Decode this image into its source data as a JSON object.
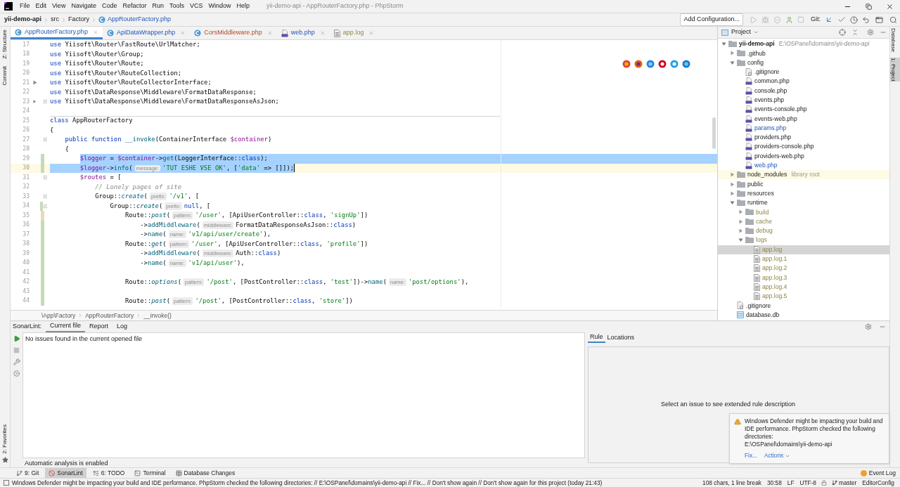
{
  "menu": [
    "File",
    "Edit",
    "View",
    "Navigate",
    "Code",
    "Refactor",
    "Run",
    "Tools",
    "VCS",
    "Window",
    "Help"
  ],
  "window_title": "yii-demo-api - AppRouterFactory.php - PhpStorm",
  "nav_path": [
    {
      "label": "yii-demo-api",
      "kind": "project"
    },
    {
      "label": "src",
      "kind": "folder"
    },
    {
      "label": "Factory",
      "kind": "folder"
    },
    {
      "label": "AppRouterFactory.php",
      "kind": "class"
    }
  ],
  "run_config": "Add Configuration...",
  "vcs_label": "Git:",
  "tabs": [
    {
      "label": "AppRouterFactory.php",
      "kind": "class",
      "modified": true,
      "has_errors": false,
      "ignored": false,
      "selected": true
    },
    {
      "label": "ApiDataWrapper.php",
      "kind": "class",
      "modified": true,
      "has_errors": false,
      "ignored": false,
      "selected": false
    },
    {
      "label": "CorsMiddleware.php",
      "kind": "class",
      "modified": false,
      "has_errors": true,
      "ignored": false,
      "selected": false
    },
    {
      "label": "web.php",
      "kind": "php",
      "modified": true,
      "has_errors": false,
      "ignored": false,
      "selected": false
    },
    {
      "label": "app.log",
      "kind": "log",
      "modified": false,
      "has_errors": false,
      "ignored": true,
      "selected": false
    }
  ],
  "lines": [
    {
      "number": "17",
      "tokens": [
        {
          "kind": "kw",
          "text": "use "
        },
        {
          "kind": "plain",
          "text": "Yiisoft\\Router\\FastRoute\\UrlMatcher;"
        }
      ]
    },
    {
      "number": "18",
      "tokens": [
        {
          "kind": "kw",
          "text": "use "
        },
        {
          "kind": "plain",
          "text": "Yiisoft\\Router\\Group;"
        }
      ]
    },
    {
      "number": "19",
      "tokens": [
        {
          "kind": "kw",
          "text": "use "
        },
        {
          "kind": "plain",
          "text": "Yiisoft\\Router\\Route;"
        }
      ]
    },
    {
      "number": "20",
      "tokens": [
        {
          "kind": "kw",
          "text": "use "
        },
        {
          "kind": "plain",
          "text": "Yiisoft\\Router\\RouteCollection;"
        }
      ]
    },
    {
      "number": "21",
      "arrow": true,
      "tokens": [
        {
          "kind": "kw",
          "text": "use "
        },
        {
          "kind": "plain",
          "text": "Yiisoft\\Router\\RouteCollectorInterface;"
        }
      ]
    },
    {
      "number": "22",
      "tokens": [
        {
          "kind": "kw",
          "text": "use "
        },
        {
          "kind": "plain",
          "text": "Yiisoft\\DataResponse\\Middleware\\FormatDataResponse;"
        }
      ]
    },
    {
      "number": "23",
      "arrow": true,
      "fold": true,
      "tokens": [
        {
          "kind": "kw",
          "text": "use "
        },
        {
          "kind": "plain",
          "text": "Yiisoft\\DataResponse\\Middleware\\FormatDataResponseAsJson;"
        }
      ]
    },
    {
      "number": "24"
    },
    {
      "number": "25",
      "separator": true,
      "tokens": [
        {
          "kind": "kw",
          "text": "class "
        },
        {
          "kind": "plain",
          "text": "AppRouterFactory"
        }
      ]
    },
    {
      "number": "26",
      "tokens": [
        {
          "kind": "plain",
          "text": "{"
        }
      ],
      "children": [
        {
          "number": "27",
          "fold": true,
          "tokens": [
            {
              "kind": "kw",
              "text": "public function "
            },
            {
              "kind": "fn",
              "text": "__invoke"
            },
            {
              "kind": "plain",
              "text": "(ContainerInterface "
            },
            {
              "kind": "var",
              "text": "$container"
            },
            {
              "kind": "plain",
              "text": ")"
            }
          ]
        },
        {
          "number": "28",
          "tokens": [
            {
              "kind": "plain",
              "text": "{"
            }
          ],
          "children": [
            {
              "number": "29",
              "color": "#c3dcb6",
              "highlighted": true,
              "tokens": [
                {
                  "kind": "var",
                  "text": "$logger"
                },
                {
                  "kind": "plain",
                  "text": " = "
                },
                {
                  "kind": "var",
                  "text": "$container"
                },
                {
                  "kind": "plain",
                  "text": "->"
                },
                {
                  "kind": "fn",
                  "text": "get"
                },
                {
                  "kind": "plain",
                  "text": "(LoggerInterface::"
                },
                {
                  "kind": "kw",
                  "text": "class"
                },
                {
                  "kind": "plain",
                  "text": ");"
                }
              ]
            },
            {
              "number": "30",
              "color": "#c3dcb6",
              "highlighted": true,
              "caret": true,
              "tokens": [
                {
                  "kind": "var",
                  "text": "$logger"
                },
                {
                  "kind": "plain",
                  "text": "->"
                },
                {
                  "kind": "fn",
                  "text": "info"
                },
                {
                  "kind": "plain",
                  "text": "("
                },
                {
                  "kind": "hint",
                  "text": "message:"
                },
                {
                  "kind": "str",
                  "text": "'TUT ESHE VSE OK'"
                },
                {
                  "kind": "plain",
                  "text": ", ["
                },
                {
                  "kind": "str",
                  "text": "'data'"
                },
                {
                  "kind": "plain",
                  "text": " => []]);"
                }
              ]
            },
            {
              "number": "31",
              "fold": true,
              "tokens": [
                {
                  "kind": "var",
                  "text": "$routes"
                },
                {
                  "kind": "plain",
                  "text": " = ["
                }
              ],
              "children": [
                {
                  "number": "32",
                  "tokens": [
                    {
                      "kind": "comment",
                      "text": "// Lonely pages of site"
                    }
                  ]
                },
                {
                  "number": "33",
                  "fold": true,
                  "tokens": [
                    {
                      "kind": "plain",
                      "text": "Group::"
                    },
                    {
                      "kind": "static",
                      "text": "create"
                    },
                    {
                      "kind": "plain",
                      "text": "("
                    },
                    {
                      "kind": "hint",
                      "text": "prefix:"
                    },
                    {
                      "kind": "str",
                      "text": "'/v1'"
                    },
                    {
                      "kind": "plain",
                      "text": ", ["
                    }
                  ],
                  "children": [
                    {
                      "number": "34",
                      "fold": true,
                      "color": "#c3dcb6",
                      "tokens": [
                        {
                          "kind": "plain",
                          "text": "Group::"
                        },
                        {
                          "kind": "static",
                          "text": "create"
                        },
                        {
                          "kind": "plain",
                          "text": "("
                        },
                        {
                          "kind": "hint",
                          "text": "prefix:"
                        },
                        {
                          "kind": "kw",
                          "text": "null"
                        },
                        {
                          "kind": "plain",
                          "text": ", ["
                        }
                      ],
                      "children": [
                        {
                          "number": "35",
                          "color": "#ead9b6",
                          "tokens": [
                            {
                              "kind": "plain",
                              "text": "Route::"
                            },
                            {
                              "kind": "static",
                              "text": "post"
                            },
                            {
                              "kind": "plain",
                              "text": "("
                            },
                            {
                              "kind": "hint",
                              "text": "pattern:"
                            },
                            {
                              "kind": "str",
                              "text": "'/user'"
                            },
                            {
                              "kind": "plain",
                              "text": ", [ApiUserController::"
                            },
                            {
                              "kind": "kw",
                              "text": "class"
                            },
                            {
                              "kind": "plain",
                              "text": ", "
                            },
                            {
                              "kind": "str",
                              "text": "'signUp'"
                            },
                            {
                              "kind": "plain",
                              "text": "])"
                            }
                          ],
                          "children": [
                            {
                              "number": "36",
                              "color": "#c3dcb6",
                              "tokens": [
                                {
                                  "kind": "plain",
                                  "text": "->"
                                },
                                {
                                  "kind": "fn",
                                  "text": "addMiddleware"
                                },
                                {
                                  "kind": "plain",
                                  "text": "("
                                },
                                {
                                  "kind": "hint",
                                  "text": "middleware:"
                                },
                                {
                                  "kind": "plain",
                                  "text": "FormatDataResponseAsJson::"
                                },
                                {
                                  "kind": "kw",
                                  "text": "class"
                                },
                                {
                                  "kind": "plain",
                                  "text": ")"
                                }
                              ]
                            },
                            {
                              "number": "37",
                              "color": "#c3dcb6",
                              "tokens": [
                                {
                                  "kind": "plain",
                                  "text": "->"
                                },
                                {
                                  "kind": "fn",
                                  "text": "name"
                                },
                                {
                                  "kind": "plain",
                                  "text": "("
                                },
                                {
                                  "kind": "hint",
                                  "text": "name:"
                                },
                                {
                                  "kind": "str",
                                  "text": "'v1/api/user/create'"
                                },
                                {
                                  "kind": "plain",
                                  "text": "),"
                                }
                              ]
                            }
                          ]
                        },
                        {
                          "number": "38",
                          "color": "#c3dcb6",
                          "tokens": [
                            {
                              "kind": "plain",
                              "text": "Route::"
                            },
                            {
                              "kind": "static",
                              "text": "get"
                            },
                            {
                              "kind": "plain",
                              "text": "("
                            },
                            {
                              "kind": "hint",
                              "text": "pattern:"
                            },
                            {
                              "kind": "str",
                              "text": "'/user'"
                            },
                            {
                              "kind": "plain",
                              "text": ", [ApiUserController::"
                            },
                            {
                              "kind": "kw",
                              "text": "class"
                            },
                            {
                              "kind": "plain",
                              "text": ", "
                            },
                            {
                              "kind": "str",
                              "text": "'profile'"
                            },
                            {
                              "kind": "plain",
                              "text": "])"
                            }
                          ],
                          "children": [
                            {
                              "number": "39",
                              "color": "#c3dcb6",
                              "tokens": [
                                {
                                  "kind": "plain",
                                  "text": "->"
                                },
                                {
                                  "kind": "fn",
                                  "text": "addMiddleware"
                                },
                                {
                                  "kind": "plain",
                                  "text": "("
                                },
                                {
                                  "kind": "hint",
                                  "text": "middleware:"
                                },
                                {
                                  "kind": "plain",
                                  "text": "Auth::"
                                },
                                {
                                  "kind": "kw",
                                  "text": "class"
                                },
                                {
                                  "kind": "plain",
                                  "text": ")"
                                }
                              ]
                            },
                            {
                              "number": "40",
                              "color": "#c3dcb6",
                              "tokens": [
                                {
                                  "kind": "plain",
                                  "text": "->"
                                },
                                {
                                  "kind": "fn",
                                  "text": "name"
                                },
                                {
                                  "kind": "plain",
                                  "text": "("
                                },
                                {
                                  "kind": "hint",
                                  "text": "name:"
                                },
                                {
                                  "kind": "str",
                                  "text": "'v1/api/user'"
                                },
                                {
                                  "kind": "plain",
                                  "text": "),"
                                }
                              ]
                            }
                          ]
                        },
                        {
                          "number": "41",
                          "color": "#c3dcb6"
                        },
                        {
                          "number": "42",
                          "color": "#c3dcb6",
                          "tokens": [
                            {
                              "kind": "plain",
                              "text": "Route::"
                            },
                            {
                              "kind": "static",
                              "text": "options"
                            },
                            {
                              "kind": "plain",
                              "text": "("
                            },
                            {
                              "kind": "hint",
                              "text": "pattern:"
                            },
                            {
                              "kind": "str",
                              "text": "'/post'"
                            },
                            {
                              "kind": "plain",
                              "text": ", [PostController::"
                            },
                            {
                              "kind": "kw",
                              "text": "class"
                            },
                            {
                              "kind": "plain",
                              "text": ", "
                            },
                            {
                              "kind": "str",
                              "text": "'test'"
                            },
                            {
                              "kind": "plain",
                              "text": "])->"
                            },
                            {
                              "kind": "fn",
                              "text": "name"
                            },
                            {
                              "kind": "plain",
                              "text": "("
                            },
                            {
                              "kind": "hint",
                              "text": "name:"
                            },
                            {
                              "kind": "str",
                              "text": "'post/options'"
                            },
                            {
                              "kind": "plain",
                              "text": "),"
                            }
                          ]
                        },
                        {
                          "number": "43",
                          "color": "#c3dcb6"
                        },
                        {
                          "number": "44",
                          "color": "#c3dcb6",
                          "tokens": [
                            {
                              "kind": "plain",
                              "text": "Route::"
                            },
                            {
                              "kind": "static",
                              "text": "post"
                            },
                            {
                              "kind": "plain",
                              "text": "("
                            },
                            {
                              "kind": "hint",
                              "text": "pattern:"
                            },
                            {
                              "kind": "str",
                              "text": "'/post'"
                            },
                            {
                              "kind": "plain",
                              "text": ", [PostController::"
                            },
                            {
                              "kind": "kw",
                              "text": "class"
                            },
                            {
                              "kind": "plain",
                              "text": ", "
                            },
                            {
                              "kind": "str",
                              "text": "'store'"
                            },
                            {
                              "kind": "plain",
                              "text": "])"
                            }
                          ]
                        }
                      ]
                    }
                  ]
                }
              ]
            }
          ]
        }
      ]
    }
  ],
  "editor_breadcrumb": [
    "\\App\\Factory",
    "AppRouterFactory",
    "__invoke()"
  ],
  "project": {
    "title": "Project",
    "tree": [
      {
        "name": "yii-demo-api",
        "path": "E:\\OSPanel\\domains\\yii-demo-api",
        "kind": "folder",
        "expanded": true,
        "selected": false,
        "children": [
          {
            "name": ".github",
            "kind": "folder",
            "expanded": false,
            "selected": false
          },
          {
            "name": "config",
            "kind": "folder",
            "expanded": true,
            "selected": false,
            "children": [
              {
                "name": ".gitignore",
                "kind": "git",
                "selected": false
              },
              {
                "name": "common.php",
                "kind": "php",
                "selected": false
              },
              {
                "name": "console.php",
                "kind": "php",
                "selected": false
              },
              {
                "name": "events.php",
                "kind": "php",
                "selected": false
              },
              {
                "name": "events-console.php",
                "kind": "php",
                "selected": false
              },
              {
                "name": "events-web.php",
                "kind": "php",
                "selected": false
              },
              {
                "name": "params.php",
                "kind": "php",
                "modified": true,
                "selected": false
              },
              {
                "name": "providers.php",
                "kind": "php",
                "selected": false
              },
              {
                "name": "providers-console.php",
                "kind": "php",
                "selected": false
              },
              {
                "name": "providers-web.php",
                "kind": "php",
                "selected": false
              },
              {
                "name": "web.php",
                "kind": "php",
                "modified": true,
                "selected": false
              }
            ]
          },
          {
            "name": "node_modules",
            "suffix": "library root",
            "kind": "folder",
            "highlighted": true,
            "expanded": false,
            "selected": false
          },
          {
            "name": "public",
            "kind": "folder",
            "expanded": false,
            "selected": false
          },
          {
            "name": "resources",
            "kind": "folder",
            "expanded": false,
            "selected": false
          },
          {
            "name": "runtime",
            "kind": "folder",
            "expanded": true,
            "selected": false,
            "children": [
              {
                "name": "build",
                "kind": "folder",
                "ignored": true,
                "expanded": false,
                "selected": false
              },
              {
                "name": "cache",
                "kind": "folder",
                "ignored": true,
                "expanded": false,
                "selected": false
              },
              {
                "name": "debug",
                "kind": "folder",
                "ignored": true,
                "expanded": false,
                "selected": false
              },
              {
                "name": "logs",
                "kind": "folder",
                "ignored": true,
                "expanded": true,
                "selected": false,
                "children": [
                  {
                    "name": "app.log",
                    "kind": "log",
                    "ignored": true,
                    "selected": true
                  },
                  {
                    "name": "app.log.1",
                    "kind": "log",
                    "ignored": true,
                    "selected": false
                  },
                  {
                    "name": "app.log.2",
                    "kind": "log",
                    "ignored": true,
                    "selected": false
                  },
                  {
                    "name": "app.log.3",
                    "kind": "log",
                    "ignored": true,
                    "selected": false
                  },
                  {
                    "name": "app.log.4",
                    "kind": "log",
                    "ignored": true,
                    "selected": false
                  },
                  {
                    "name": "app.log.5",
                    "kind": "log",
                    "ignored": true,
                    "selected": false
                  }
                ]
              }
            ]
          },
          {
            "name": ".gitignore",
            "kind": "git",
            "selected": false
          },
          {
            "name": "database.db",
            "kind": "db",
            "selected": false
          }
        ]
      }
    ]
  },
  "side_left": [
    {
      "label": "Z: Structure",
      "selected": false
    },
    {
      "label": "Commit",
      "selected": false
    }
  ],
  "side_left_bottom": "2: Favorites",
  "side_right": [
    {
      "label": "Database",
      "selected": false
    },
    {
      "label": "1: Project",
      "selected": true
    }
  ],
  "sonarlint": {
    "title": "SonarLint:",
    "tabs": [
      {
        "label": "Current file",
        "selected": true
      },
      {
        "label": "Report",
        "selected": false
      },
      {
        "label": "Log",
        "selected": false
      }
    ],
    "message": "No issues found in the current opened file",
    "footer": "Automatic analysis is enabled",
    "detail_tabs": [
      {
        "label": "Rule",
        "selected": true
      },
      {
        "label": "Locations",
        "selected": false
      }
    ],
    "detail_message": "Select an issue to see extended rule description"
  },
  "notification": {
    "text": "Windows Defender might be impacting your build and IDE performance. PhpStorm checked the following directories:",
    "path": "E:\\OSPanel\\domains\\yii-demo-api",
    "links": [
      "Fix...",
      "Actions"
    ]
  },
  "tool_strip": [
    {
      "label": "9: Git",
      "kind": "git",
      "selected": false
    },
    {
      "label": "SonarLint",
      "kind": "sonar",
      "selected": true
    },
    {
      "label": "6: TODO",
      "kind": "todo",
      "selected": false
    },
    {
      "label": "Terminal",
      "kind": "terminal",
      "selected": false
    },
    {
      "label": "Database Changes",
      "kind": "db",
      "selected": false
    }
  ],
  "event_log": "Event Log",
  "status_bar": {
    "message": "Windows Defender might be impacting your build and IDE performance. PhpStorm checked the following directories: // E:\\OSPanel\\domains\\yii-demo-api // Fix... // Don't show again // Don't show again for this project (today 21:43)",
    "items": [
      "108 chars, 1 line break",
      "30:58",
      "LF",
      "UTF-8"
    ],
    "branch": "master",
    "config": "EditorConfig"
  }
}
